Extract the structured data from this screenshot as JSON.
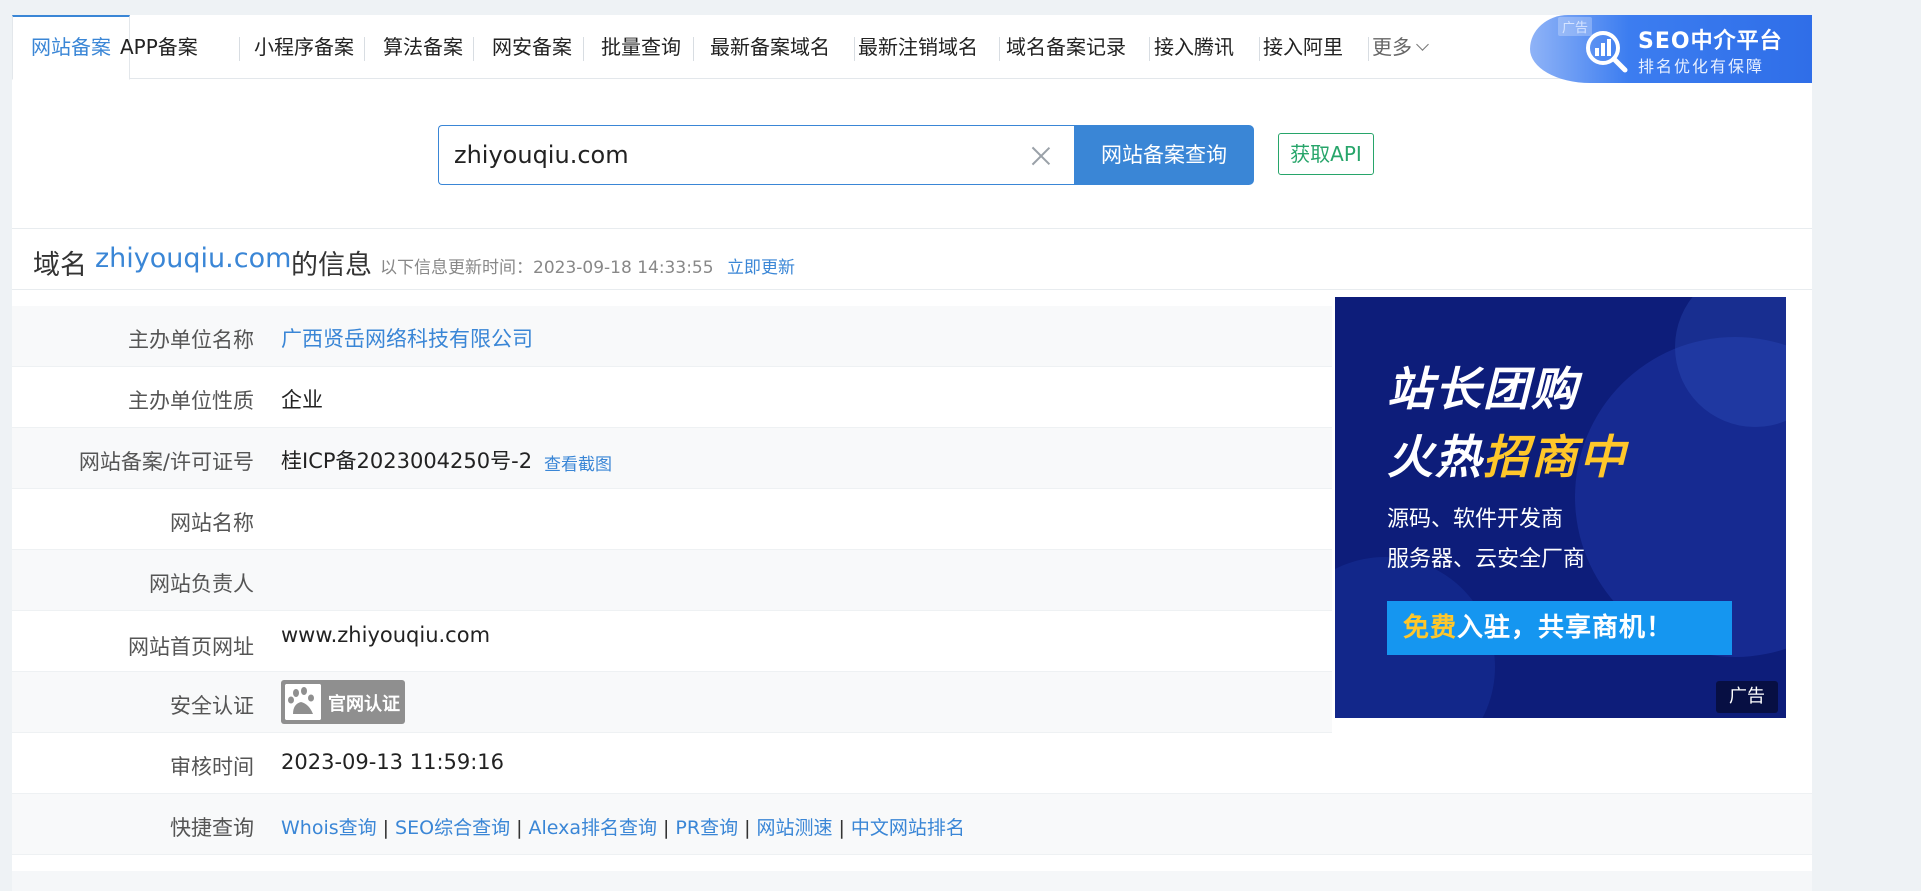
{
  "nav": {
    "tabs": [
      {
        "label": "网站备案",
        "active": true
      },
      {
        "label": "APP备案"
      },
      {
        "label": "小程序备案"
      },
      {
        "label": "算法备案"
      },
      {
        "label": "网安备案"
      },
      {
        "label": "批量查询"
      },
      {
        "label": "最新备案域名"
      },
      {
        "label": "最新注销域名"
      },
      {
        "label": "域名备案记录"
      },
      {
        "label": "接入腾讯"
      },
      {
        "label": "接入阿里"
      },
      {
        "label": "更多"
      }
    ],
    "seo_ad": {
      "tag": "广告",
      "title": "SEO中介平台",
      "subtitle": "排名优化有保障"
    }
  },
  "search": {
    "value": "zhiyouqiu.com",
    "button": "网站备案查询",
    "api_button": "获取API"
  },
  "info": {
    "prefix": "域名",
    "domain": "zhiyouqiu.com",
    "suffix": "的信息",
    "update_time": "以下信息更新时间：2023-09-18 14:33:55",
    "update_link": "立即更新"
  },
  "rows": {
    "organizer_name": {
      "label": "主办单位名称",
      "value": "广西贤岳网络科技有限公司"
    },
    "organizer_type": {
      "label": "主办单位性质",
      "value": "企业"
    },
    "license": {
      "label": "网站备案/许可证号",
      "value": "桂ICP备2023004250号-2",
      "link": "查看截图"
    },
    "site_name": {
      "label": "网站名称",
      "value": ""
    },
    "site_owner": {
      "label": "网站负责人",
      "value": ""
    },
    "homepage": {
      "label": "网站首页网址",
      "value": "www.zhiyouqiu.com"
    },
    "security": {
      "label": "安全认证",
      "badge": "官网认证"
    },
    "audit_time": {
      "label": "审核时间",
      "value": "2023-09-13 11:59:16"
    },
    "quick": {
      "label": "快捷查询",
      "links": [
        "Whois查询",
        "SEO综合查询",
        "Alexa排名查询",
        "PR查询",
        "网站测速",
        "中文网站排名"
      ],
      "separator": "|"
    }
  },
  "ad": {
    "headline1": "站长团购",
    "headline2_a": "火热",
    "headline2_b": "招商中",
    "sub1": "源码、软件开发商",
    "sub2": "服务器、云安全厂商",
    "cta_a": "免费",
    "cta_b": "入驻，共享商机！",
    "label": "广告"
  },
  "colors": {
    "accent": "#3a86d6",
    "api_green": "#27a56a",
    "ad_bg": "#0d1d7a",
    "ad_highlight": "#ffc72a"
  }
}
